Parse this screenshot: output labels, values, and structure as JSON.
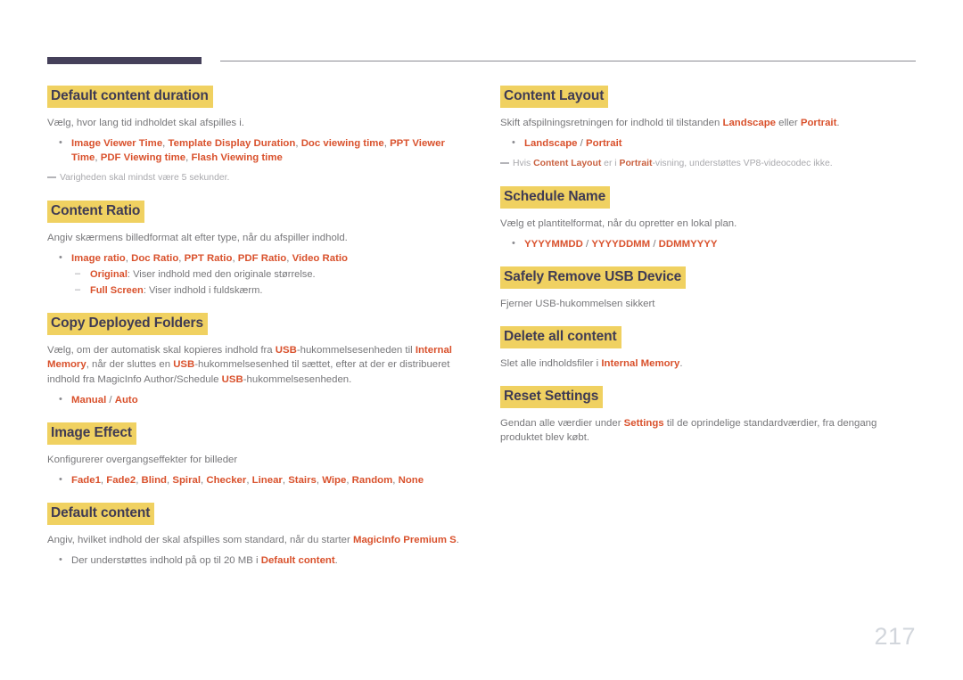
{
  "document": {
    "page_number": "217",
    "colors": {
      "heading_highlight": "#f0d161",
      "heading_text": "#3f3b54",
      "accent": "#d9512c",
      "body_text": "#77777a",
      "rule_dark": "#45405a",
      "rule_light": "#8b8b93",
      "page_number": "#d2d6dc"
    }
  },
  "left_column": {
    "sections": [
      {
        "heading": "Default content duration",
        "paragraph": "Vælg, hvor lang tid indholdet skal afspilles i.",
        "bullet": {
          "part1": "Image Viewer Time",
          "sep1": ", ",
          "part2": "Template Display Duration",
          "sep2": ", ",
          "part3": "Doc viewing time",
          "sep3": ", ",
          "part4": "PPT Viewer Time",
          "sep4": ", ",
          "part5": "PDF Viewing time",
          "sep5": ", ",
          "part6": "Flash Viewing time"
        },
        "note": "Varigheden skal mindst være 5 sekunder."
      },
      {
        "heading": "Content Ratio",
        "paragraph": "Angiv skærmens billedformat alt efter type, når du afspiller indhold.",
        "bullet": {
          "part1": "Image ratio",
          "sep1": ", ",
          "part2": "Doc Ratio",
          "sep2": ", ",
          "part3": "PPT Ratio",
          "sep3": ", ",
          "part4": "PDF Ratio",
          "sep4": ", ",
          "part5": "Video Ratio"
        },
        "sub_items": [
          {
            "term": "Original",
            "text": ": Viser indhold med den originale størrelse."
          },
          {
            "term": "Full Screen",
            "text": ": Viser indhold i fuldskærm."
          }
        ]
      },
      {
        "heading": "Copy Deployed Folders",
        "paragraph": {
          "t1": "Vælg, om der automatisk skal kopieres indhold fra ",
          "a1": "USB",
          "t2": "-hukommelsesenheden til ",
          "a2": "Internal Memory",
          "t3": ", når der sluttes en ",
          "a3": "USB",
          "t4": "-hukommelsesenhed til sættet, efter at der er distribueret indhold fra MagicInfo Author/Schedule ",
          "a4": "USB",
          "t5": "-hukommelsesenheden."
        },
        "bullet": {
          "part1": "Manual",
          "sep1": " / ",
          "part2": "Auto"
        }
      },
      {
        "heading": "Image Effect",
        "paragraph": "Konfigurerer overgangseffekter for billeder",
        "bullet_options": [
          "Fade1",
          "Fade2",
          "Blind",
          "Spiral",
          "Checker",
          "Linear",
          "Stairs",
          "Wipe",
          "Random",
          "None"
        ]
      },
      {
        "heading": "Default content",
        "paragraph": {
          "t1": "Angiv, hvilket indhold der skal afspilles som standard, når du starter ",
          "a1": "MagicInfo Premium S",
          "t2": "."
        },
        "bullet_plain": {
          "t1": "Der understøttes indhold på op til 20 MB i ",
          "a1": "Default content",
          "t2": "."
        }
      }
    ]
  },
  "right_column": {
    "sections": [
      {
        "heading": "Content Layout",
        "paragraph": {
          "t1": "Skift afspilningsretningen for indhold til tilstanden ",
          "a1": "Landscape",
          "t2": " eller ",
          "a2": "Portrait",
          "t3": "."
        },
        "bullet": {
          "part1": "Landscape",
          "sep1": " / ",
          "part2": "Portrait"
        },
        "note": {
          "t1": "Hvis ",
          "a1": "Content Layout",
          "t2": " er i ",
          "a2": "Portrait",
          "t3": "-visning, understøttes VP8-videocodec ikke."
        }
      },
      {
        "heading": "Schedule Name",
        "paragraph": "Vælg et plantitelformat, når du opretter en lokal plan.",
        "bullet": {
          "part1": "YYYYMMDD",
          "sep1": " / ",
          "part2": "YYYYDDMM",
          "sep2": " / ",
          "part3": "DDMMYYYY"
        }
      },
      {
        "heading": "Safely Remove USB Device",
        "paragraph": "Fjerner USB-hukommelsen sikkert"
      },
      {
        "heading": "Delete all content",
        "paragraph": {
          "t1": "Slet alle indholdsfiler i ",
          "a1": "Internal Memory",
          "t2": "."
        }
      },
      {
        "heading": "Reset Settings",
        "paragraph": {
          "t1": "Gendan alle værdier under ",
          "a1": "Settings",
          "t2": " til de oprindelige standardværdier, fra dengang produktet blev købt."
        }
      }
    ]
  }
}
